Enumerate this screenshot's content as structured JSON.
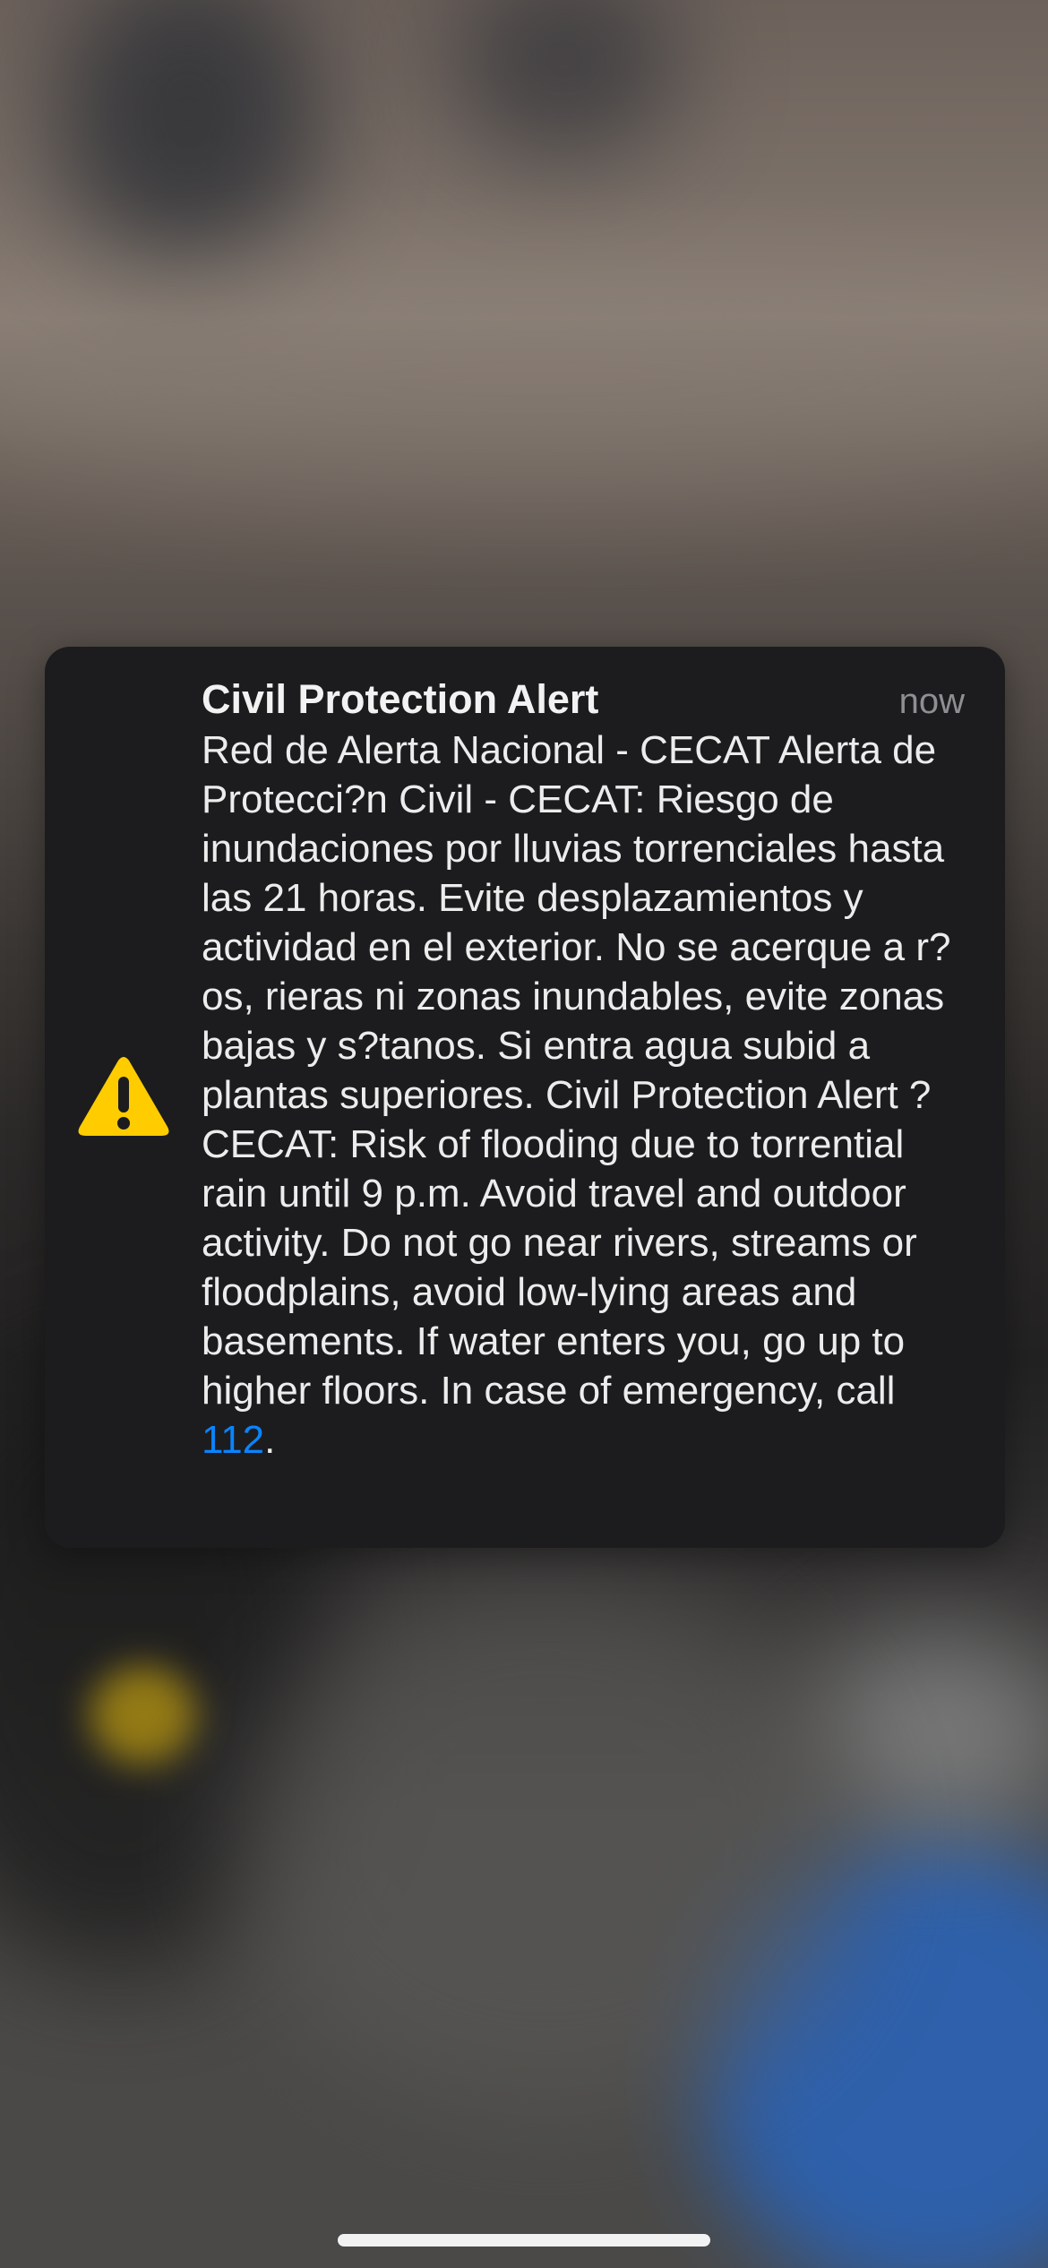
{
  "notification": {
    "title": "Civil Protection Alert",
    "time": "now",
    "message": "Red de Alerta Nacional - CECAT Alerta de Protecci?n Civil - CECAT: Riesgo de inundaciones por lluvias torrenciales hasta las 21 horas. Evite desplazamientos y actividad en el exterior. No se acerque a r?os, rieras ni zonas inundables, evite zonas bajas y s?tanos. Si entra agua subid a plantas superiores. Civil Protection Alert ? CECAT: Risk of flooding due to torrential rain until 9 p.m. Avoid travel and outdoor activity. Do not go near rivers, streams or floodplains, avoid low-lying areas and basements. If water enters you, go up to higher floors. In case of emergency, call ",
    "emergency_number": "112",
    "message_end": ".",
    "icon": "warning-icon",
    "colors": {
      "icon": "#ffcc00",
      "link": "#0a84ff",
      "panel": "#1c1c1e"
    }
  }
}
